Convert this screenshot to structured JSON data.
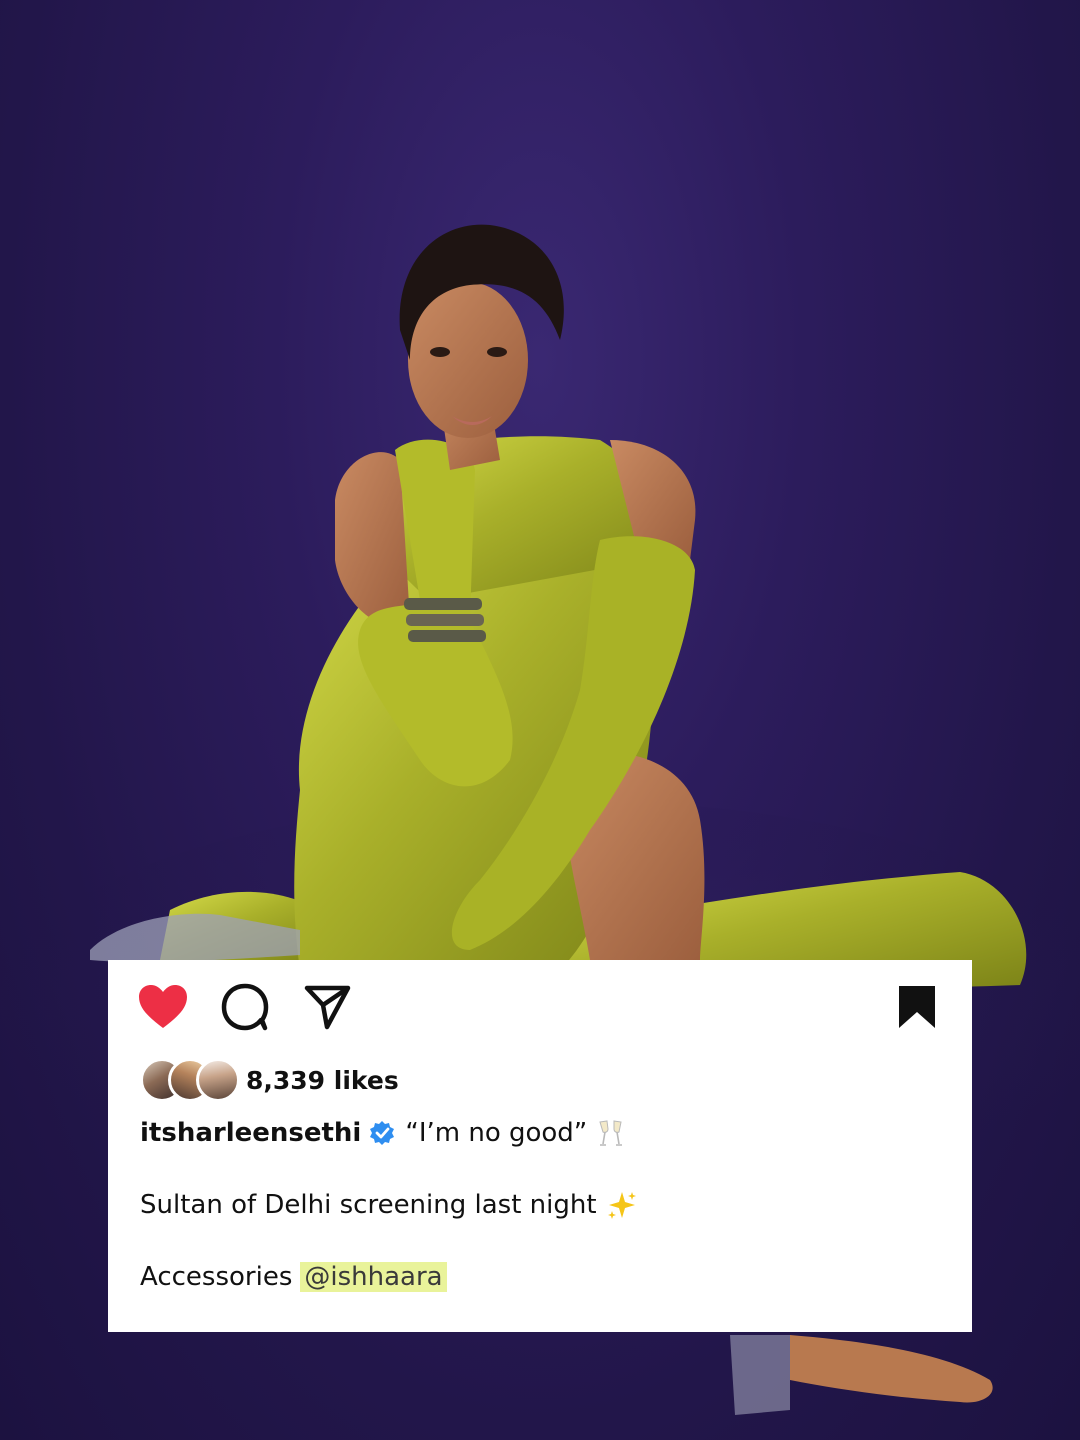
{
  "post": {
    "likes_text": "8,339 likes",
    "username": "itsharleensethi",
    "caption_quote": "“I’m no good”",
    "caption_line2": "Sultan of Delhi screening last night",
    "caption_line3_prefix": "Accessories",
    "mention": "@ishhaara"
  },
  "icons": {
    "like": "heart-icon",
    "comment": "comment-bubble-icon",
    "share": "paper-plane-icon",
    "save": "bookmark-icon",
    "verified": "verified-badge-icon",
    "toast": "champagne-toast-icon",
    "sparkles": "sparkles-icon"
  },
  "colors": {
    "background": "#2a1b52",
    "dress": "#b9c232",
    "like_red": "#ed2f45",
    "verified_blue": "#2f8ef0",
    "mention_highlight": "#e9f39a"
  }
}
